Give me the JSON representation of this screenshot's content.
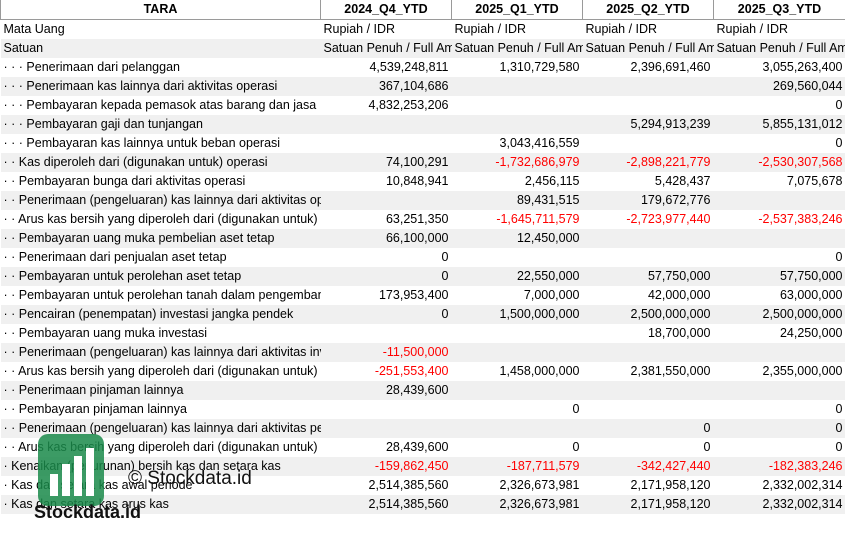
{
  "header": {
    "label_col": "TARA",
    "periods": [
      "2024_Q4_YTD",
      "2025_Q1_YTD",
      "2025_Q2_YTD",
      "2025_Q3_YTD"
    ]
  },
  "meta_rows": [
    {
      "label": "Mata Uang",
      "values": [
        "Rupiah / IDR",
        "Rupiah / IDR",
        "Rupiah / IDR",
        "Rupiah / IDR"
      ]
    },
    {
      "label": "Satuan",
      "values": [
        "Satuan Penuh / Full Amount",
        "Satuan Penuh / Full Amount",
        "Satuan Penuh / Full Amount",
        "Satuan Penuh / Full Amount"
      ]
    }
  ],
  "rows": [
    {
      "label": "· · · Penerimaan dari pelanggan",
      "values": [
        "4,539,248,811",
        "1,310,729,580",
        "2,396,691,460",
        "3,055,263,400"
      ]
    },
    {
      "label": "· · · Penerimaan kas lainnya dari aktivitas operasi",
      "values": [
        "367,104,686",
        "",
        "",
        "269,560,044"
      ]
    },
    {
      "label": "· · · Pembayaran kepada pemasok atas barang dan jasa",
      "values": [
        "4,832,253,206",
        "",
        "",
        "0"
      ]
    },
    {
      "label": "· · · Pembayaran gaji dan tunjangan",
      "values": [
        "",
        "",
        "5,294,913,239",
        "5,855,131,012"
      ]
    },
    {
      "label": "· · · Pembayaran kas lainnya untuk beban operasi",
      "values": [
        "",
        "3,043,416,559",
        "",
        "0"
      ]
    },
    {
      "label": "· · Kas diperoleh dari (digunakan untuk) operasi",
      "values": [
        "74,100,291",
        "-1,732,686,979",
        "-2,898,221,779",
        "-2,530,307,568"
      ]
    },
    {
      "label": "· · Pembayaran bunga dari aktivitas operasi",
      "values": [
        "10,848,941",
        "2,456,115",
        "5,428,437",
        "7,075,678"
      ]
    },
    {
      "label": "· · Penerimaan (pengeluaran) kas lainnya dari aktivitas operasi",
      "values": [
        "",
        "89,431,515",
        "179,672,776",
        ""
      ]
    },
    {
      "label": "· · Arus kas bersih yang diperoleh dari (digunakan untuk) aktivitas operasi",
      "values": [
        "63,251,350",
        "-1,645,711,579",
        "-2,723,977,440",
        "-2,537,383,246"
      ]
    },
    {
      "label": "· · Pembayaran uang muka pembelian aset tetap",
      "values": [
        "66,100,000",
        "12,450,000",
        "",
        ""
      ]
    },
    {
      "label": "· · Penerimaan dari penjualan aset tetap",
      "values": [
        "0",
        "",
        "",
        "0"
      ]
    },
    {
      "label": "· · Pembayaran untuk perolehan aset tetap",
      "values": [
        "0",
        "22,550,000",
        "57,750,000",
        "57,750,000"
      ]
    },
    {
      "label": "· · Pembayaran untuk perolehan tanah dalam pengembangan",
      "values": [
        "173,953,400",
        "7,000,000",
        "42,000,000",
        "63,000,000"
      ]
    },
    {
      "label": "· · Pencairan (penempatan) investasi jangka pendek",
      "values": [
        "0",
        "1,500,000,000",
        "2,500,000,000",
        "2,500,000,000"
      ]
    },
    {
      "label": "· · Pembayaran uang muka investasi",
      "values": [
        "",
        "",
        "18,700,000",
        "24,250,000"
      ]
    },
    {
      "label": "· · Penerimaan (pengeluaran) kas lainnya dari aktivitas investasi",
      "values": [
        "-11,500,000",
        "",
        "",
        ""
      ]
    },
    {
      "label": "· · Arus kas bersih yang diperoleh dari (digunakan untuk) aktivitas investasi",
      "values": [
        "-251,553,400",
        "1,458,000,000",
        "2,381,550,000",
        "2,355,000,000"
      ]
    },
    {
      "label": "· · Penerimaan pinjaman lainnya",
      "values": [
        "28,439,600",
        "",
        "",
        ""
      ]
    },
    {
      "label": "· · Pembayaran pinjaman lainnya",
      "values": [
        "",
        "0",
        "",
        "0"
      ]
    },
    {
      "label": "· · Penerimaan (pengeluaran) kas lainnya dari aktivitas pendanaan",
      "values": [
        "",
        "",
        "0",
        "0"
      ]
    },
    {
      "label": "· · Arus kas bersih yang diperoleh dari (digunakan untuk) aktivitas pendanaan",
      "values": [
        "28,439,600",
        "0",
        "0",
        "0"
      ]
    },
    {
      "label": "· Kenaikan (penurunan) bersih kas dan setara kas",
      "values": [
        "-159,862,450",
        "-187,711,579",
        "-342,427,440",
        "-182,383,246"
      ]
    },
    {
      "label": "· Kas dan setara kas awal periode",
      "values": [
        "2,514,385,560",
        "2,326,673,981",
        "2,171,958,120",
        "2,332,002,314"
      ]
    },
    {
      "label": "· Kas dan setara kas arus kas",
      "values": [
        "2,514,385,560",
        "2,326,673,981",
        "2,171,958,120",
        "2,332,002,314"
      ]
    }
  ],
  "watermark": {
    "copyright": "© Stockdata.id",
    "brand": "Stockdata.id",
    "logo_icon": "bar-chart-logo-icon",
    "brand_color": "#1a8a4a"
  },
  "colors": {
    "negative": "#ff0000"
  }
}
